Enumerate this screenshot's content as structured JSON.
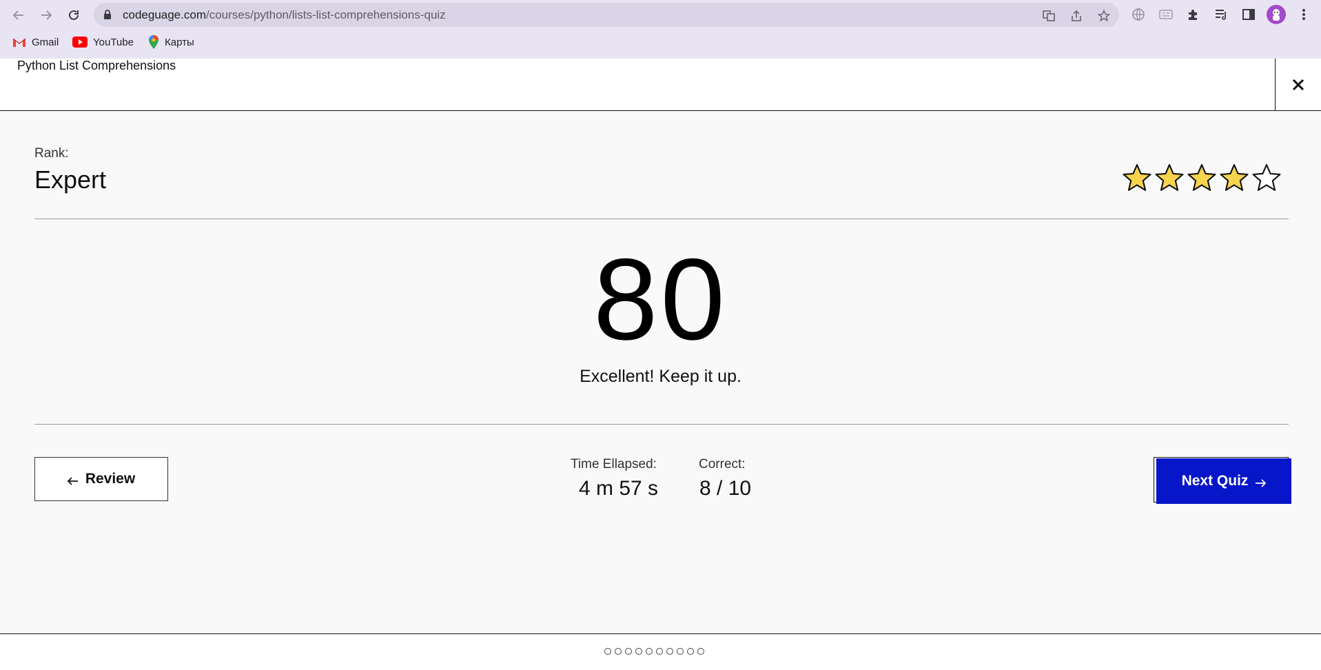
{
  "browser": {
    "url_domain": "codeguage.com",
    "url_path": "/courses/python/lists-list-comprehensions-quiz",
    "bookmarks": [
      {
        "label": "Gmail",
        "icon": "gmail-icon"
      },
      {
        "label": "YouTube",
        "icon": "youtube-icon"
      },
      {
        "label": "Карты",
        "icon": "maps-icon"
      }
    ]
  },
  "quiz": {
    "title": "Python List Comprehensions",
    "rank_label": "Rank:",
    "rank_value": "Expert",
    "stars_total": 5,
    "stars_filled": 4,
    "score": "80",
    "message": "Excellent! Keep it up.",
    "review_label": "Review",
    "next_label": "Next Quiz",
    "time_label": "Time Ellapsed:",
    "time_value": "4 m 57 s",
    "correct_label": "Correct:",
    "correct_value": "8 / 10",
    "question_dots": 10
  },
  "colors": {
    "accent": "#0716c9",
    "star_fill": "#f7d44c",
    "chrome_bg": "#e9e4f3"
  }
}
